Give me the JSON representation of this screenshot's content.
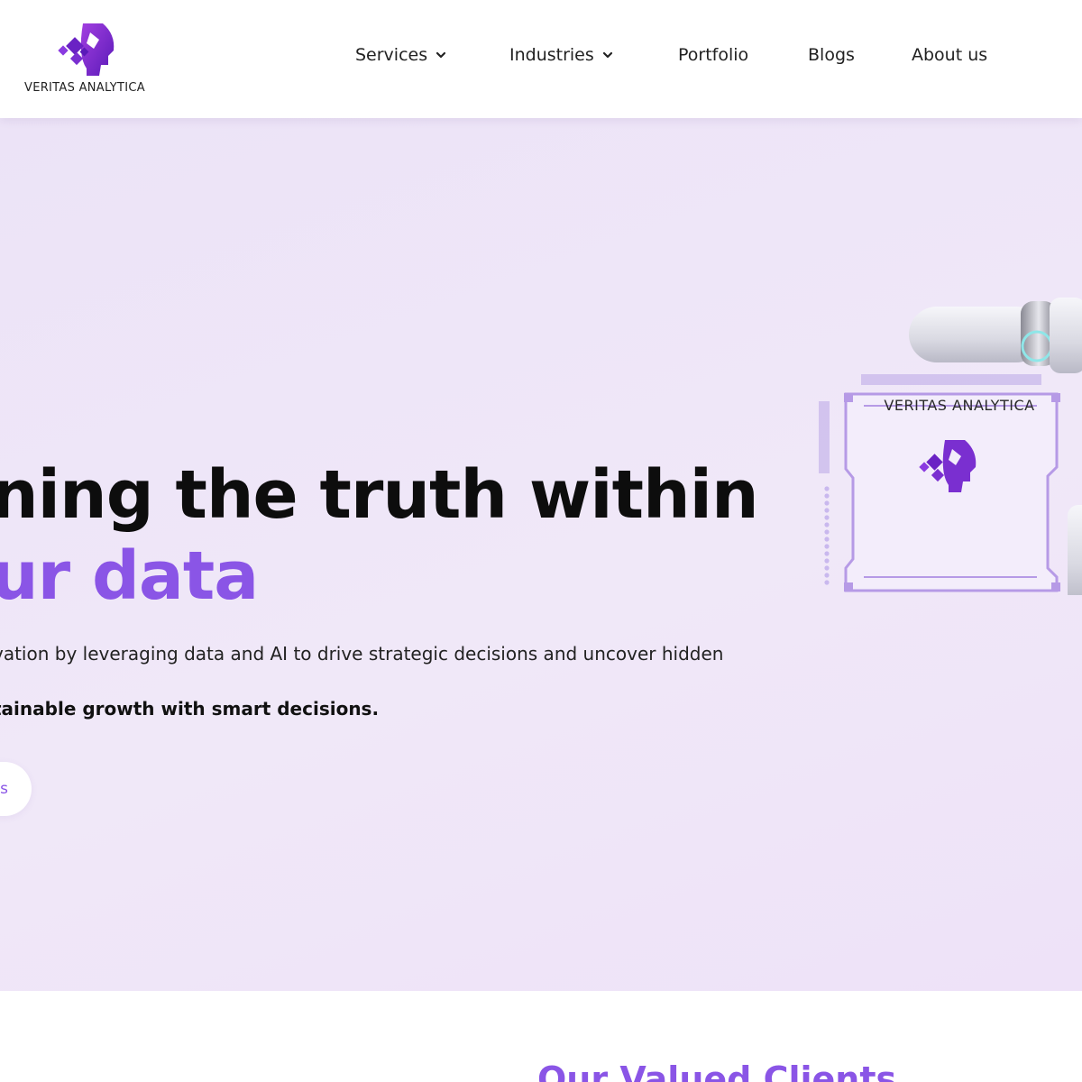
{
  "brand": {
    "name": "VERITAS ANALYTICA",
    "colors": {
      "accent": "#8a55e6",
      "logo_purple": "#7a2fd0",
      "hero_bg": "#eee5f8"
    }
  },
  "nav": {
    "items": [
      {
        "label": "Services",
        "has_dropdown": true,
        "icon": "chevron-down-icon"
      },
      {
        "label": "Industries",
        "has_dropdown": true,
        "icon": "chevron-down-icon"
      },
      {
        "label": "Portfolio",
        "has_dropdown": false
      },
      {
        "label": "Blogs",
        "has_dropdown": false
      },
      {
        "label": "About us",
        "has_dropdown": false
      }
    ]
  },
  "hero": {
    "title_line_1": "ning the truth within",
    "title_line_2": "ur data",
    "description": "vation by leveraging data and AI to drive strategic decisions and uncover hidden",
    "emphasis": "tainable growth with smart decisions.",
    "cta_label": "s",
    "illustration_logo_text": "VERITAS ANALYTICA"
  },
  "clients": {
    "title": "Our Valued Clients"
  }
}
